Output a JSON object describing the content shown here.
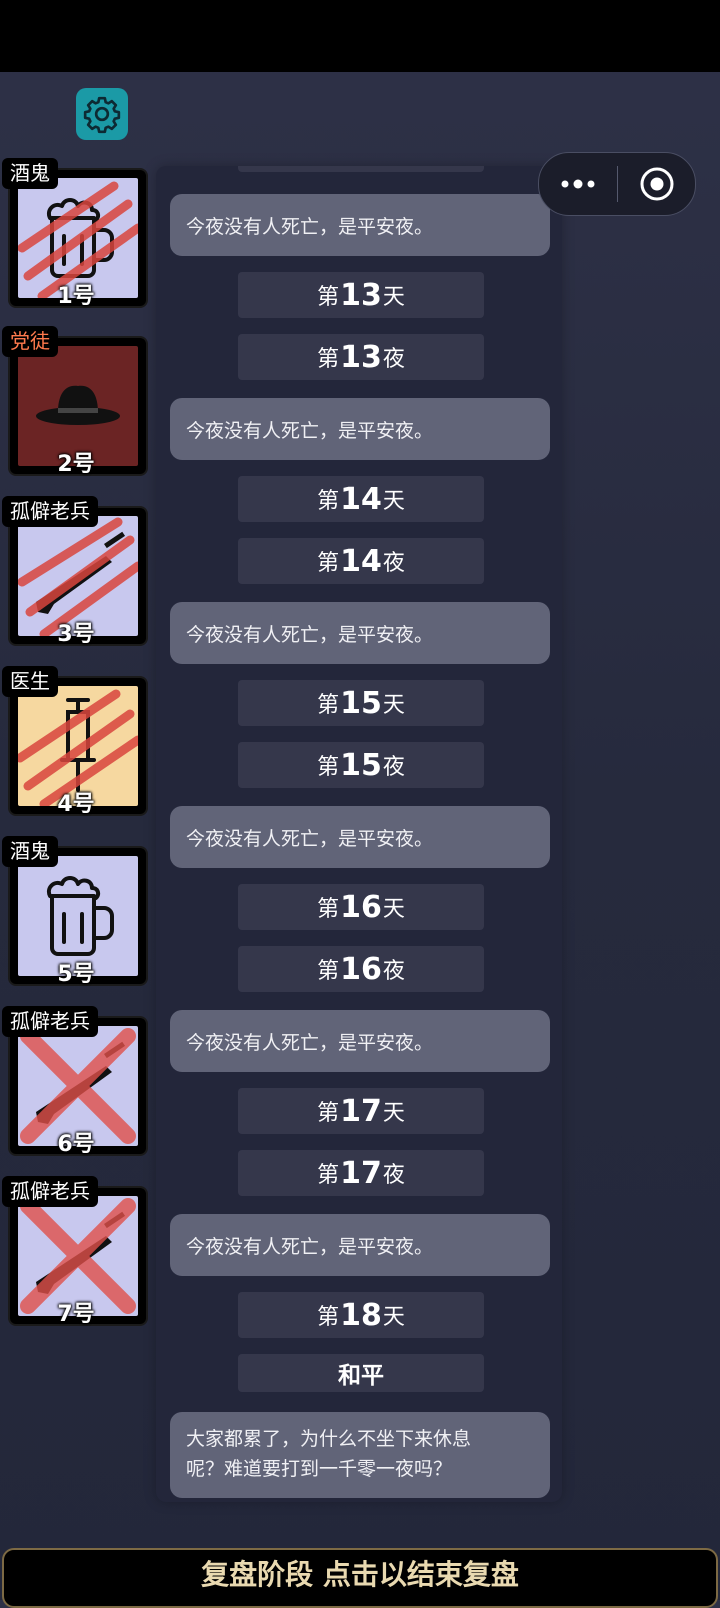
{
  "players": [
    {
      "role": "酒鬼",
      "number": "1号",
      "icon": "beer-mug-icon",
      "bg": "#c8c8ee",
      "status": "clawed"
    },
    {
      "role": "党徒",
      "number": "2号",
      "icon": "fedora-hat-icon",
      "bg": "#6b2424",
      "status": "alive"
    },
    {
      "role": "孤僻老兵",
      "number": "3号",
      "icon": "rifle-icon",
      "bg": "#c8c8ee",
      "status": "clawed"
    },
    {
      "role": "医生",
      "number": "4号",
      "icon": "syringe-icon",
      "bg": "#f6d8a0",
      "status": "clawed"
    },
    {
      "role": "酒鬼",
      "number": "5号",
      "icon": "beer-mug-icon",
      "bg": "#c8c8ee",
      "status": "alive"
    },
    {
      "role": "孤僻老兵",
      "number": "6号",
      "icon": "rifle-icon",
      "bg": "#c8c8ee",
      "status": "crossed"
    },
    {
      "role": "孤僻老兵",
      "number": "7号",
      "icon": "rifle-icon",
      "bg": "#c8c8ee",
      "status": "crossed"
    }
  ],
  "log": {
    "msg_1": "今夜没有人死亡，是平安夜。",
    "day13": {
      "pre": "第",
      "num": "13",
      "suf": "天"
    },
    "night13": {
      "pre": "第",
      "num": "13",
      "suf": "夜"
    },
    "msg_2": "今夜没有人死亡，是平安夜。",
    "day14": {
      "pre": "第",
      "num": "14",
      "suf": "天"
    },
    "night14": {
      "pre": "第",
      "num": "14",
      "suf": "夜"
    },
    "msg_3": "今夜没有人死亡，是平安夜。",
    "day15": {
      "pre": "第",
      "num": "15",
      "suf": "天"
    },
    "night15": {
      "pre": "第",
      "num": "15",
      "suf": "夜"
    },
    "msg_4": "今夜没有人死亡，是平安夜。",
    "day16": {
      "pre": "第",
      "num": "16",
      "suf": "天"
    },
    "night16": {
      "pre": "第",
      "num": "16",
      "suf": "夜"
    },
    "msg_5": "今夜没有人死亡，是平安夜。",
    "day17": {
      "pre": "第",
      "num": "17",
      "suf": "天"
    },
    "night17": {
      "pre": "第",
      "num": "17",
      "suf": "夜"
    },
    "msg_6": "今夜没有人死亡，是平安夜。",
    "day18": {
      "pre": "第",
      "num": "18",
      "suf": "天"
    },
    "result": "和平",
    "final_msg_line1": "大家都累了，为什么不坐下来休息",
    "final_msg_line2": "呢？难道要打到一千零一夜吗？"
  },
  "bottom_bar": {
    "label": "复盘阶段 点击以结束复盘"
  },
  "colors": {
    "accent": "#1b9aa6",
    "claw": "#d9463e",
    "bottom_border": "#7d6a44"
  }
}
